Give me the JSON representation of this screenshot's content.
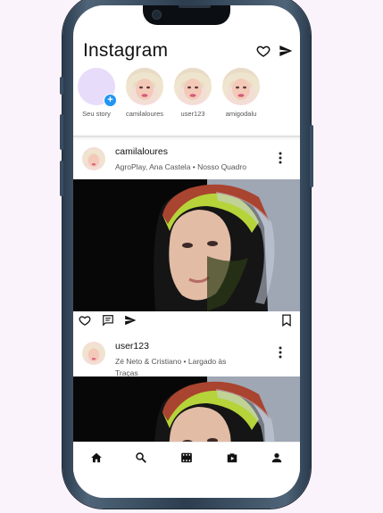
{
  "header": {
    "title": "Instagram",
    "icons": [
      "heart-icon",
      "send-icon"
    ]
  },
  "stories": [
    {
      "label": "Seu story",
      "type": "own"
    },
    {
      "label": "camilaloures",
      "type": "user"
    },
    {
      "label": "user123",
      "type": "user"
    },
    {
      "label": "amigodalu",
      "type": "user"
    }
  ],
  "posts": [
    {
      "username": "camilaloures",
      "subtitle": "AgroPlay, Ana Castela • Nosso Quadro"
    },
    {
      "username": "user123",
      "subtitle": "Zé Neto & Cristiano • Largado às Traças"
    }
  ],
  "post_actions": [
    "heart-icon",
    "comment-icon",
    "send-icon",
    "bookmark-icon"
  ],
  "bottom_nav": [
    "home-icon",
    "search-icon",
    "reels-icon",
    "shop-icon",
    "profile-icon"
  ],
  "colors": {
    "background": "#fbf3fb",
    "accent": "#2196f3",
    "own_story": "#e8dcfb"
  }
}
